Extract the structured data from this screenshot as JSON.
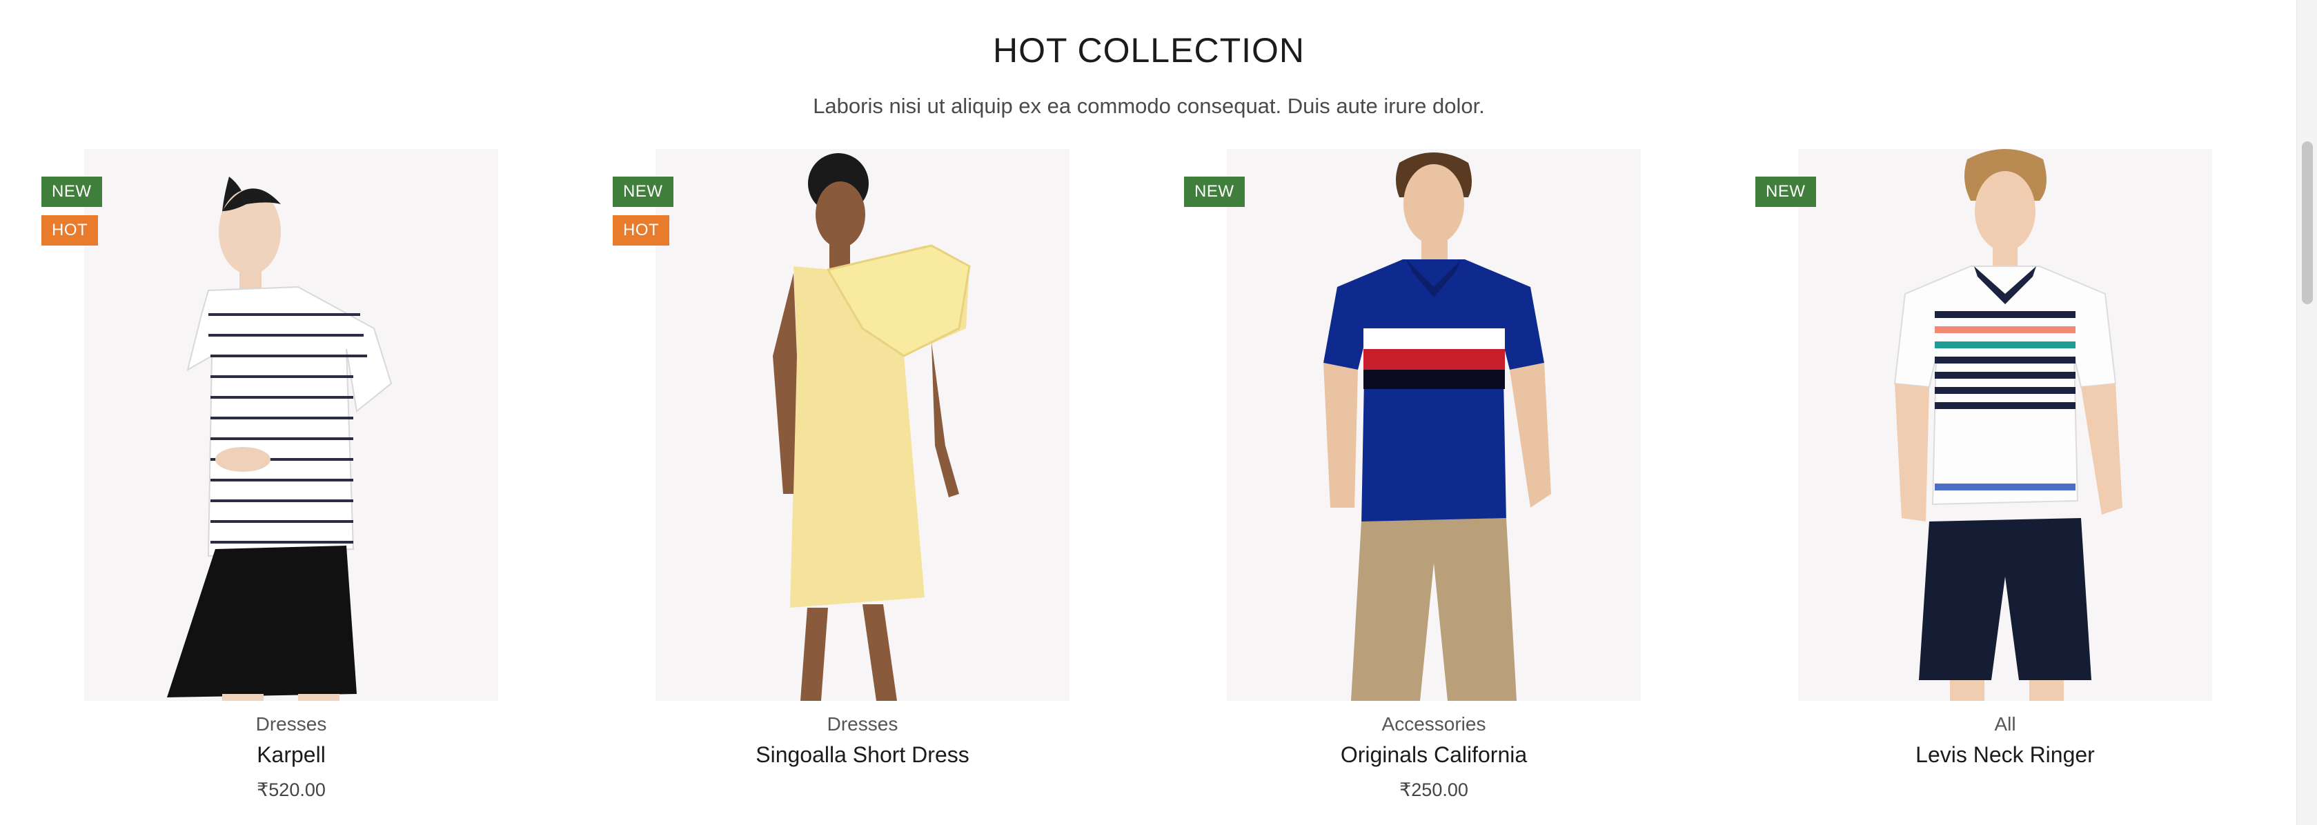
{
  "section": {
    "title": "HOT COLLECTION",
    "subtitle": "Laboris nisi ut aliquip ex ea commodo consequat. Duis aute irure dolor."
  },
  "badges": {
    "new": "NEW",
    "hot": "HOT"
  },
  "colors": {
    "new_badge": "#3f7f3b",
    "hot_badge": "#e87b2c",
    "image_bg": "#f8f5f6"
  },
  "products": [
    {
      "category": "Dresses",
      "name": "Karpell",
      "price": "₹520.00",
      "is_new": true,
      "is_hot": true,
      "image": "model-striped-top-black-shorts"
    },
    {
      "category": "Dresses",
      "name": "Singoalla Short Dress",
      "price": "",
      "is_new": true,
      "is_hot": true,
      "image": "model-yellow-ruffle-dress"
    },
    {
      "category": "Accessories",
      "name": "Originals California",
      "price": "₹250.00",
      "is_new": true,
      "is_hot": false,
      "image": "model-navy-polo-khaki-pants"
    },
    {
      "category": "All",
      "name": "Levis Neck Ringer",
      "price": "",
      "is_new": true,
      "is_hot": false,
      "image": "model-striped-polo-navy-shorts"
    }
  ]
}
